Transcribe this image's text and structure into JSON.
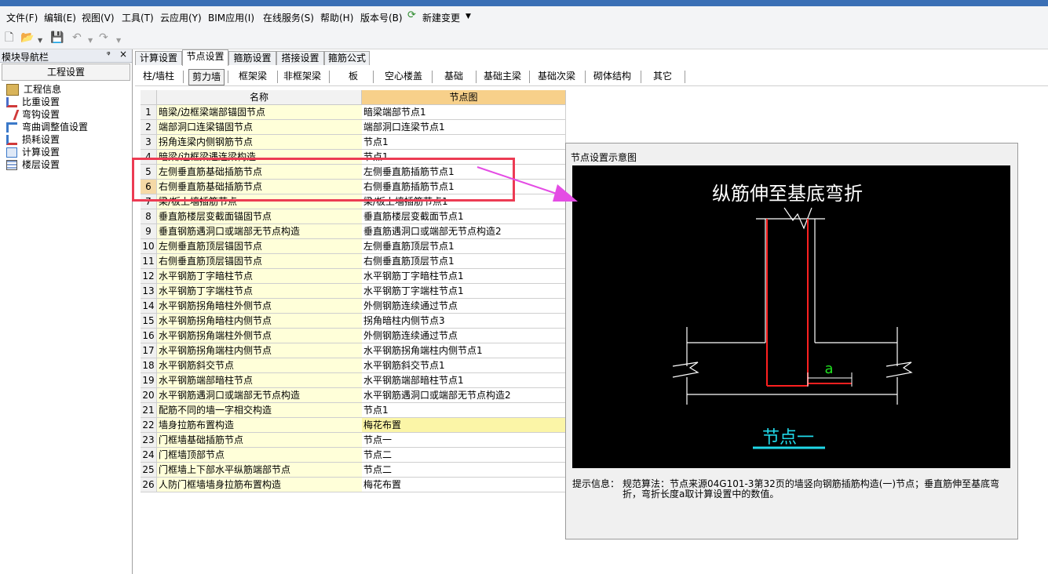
{
  "menu": [
    "文件(F)",
    "编辑(E)",
    "视图(V)",
    "工具(T)",
    "云应用(Y)",
    "BIM应用(I)",
    "在线服务(S)",
    "帮助(H)",
    "版本号(B)",
    "新建变更"
  ],
  "nav": {
    "title": "模块导航栏",
    "pin": "ᵠ",
    "close": "×",
    "group": "工程设置",
    "items": [
      "工程信息",
      "比重设置",
      "弯钩设置",
      "弯曲调整值设置",
      "损耗设置",
      "计算设置",
      "楼层设置"
    ]
  },
  "tabs": [
    "计算设置",
    "节点设置",
    "箍筋设置",
    "搭接设置",
    "箍筋公式"
  ],
  "subtabs": [
    "柱/墙柱",
    "剪力墙",
    "框架梁",
    "非框架梁",
    "板",
    "空心楼盖",
    "基础",
    "基础主梁",
    "基础次梁",
    "砌体结构",
    "其它"
  ],
  "table": {
    "headers": [
      "名称",
      "节点图"
    ],
    "rows": [
      {
        "no": "1",
        "name": "暗梁/边框梁端部锚固节点",
        "value": "暗梁端部节点1"
      },
      {
        "no": "2",
        "name": "端部洞口连梁锚固节点",
        "value": "端部洞口连梁节点1"
      },
      {
        "no": "3",
        "name": "拐角连梁内侧钢筋节点",
        "value": "节点1"
      },
      {
        "no": "4",
        "name": "暗梁/边框梁遇连梁构造",
        "value": "节点1"
      },
      {
        "no": "5",
        "name": "左侧垂直筋基础插筋节点",
        "value": "左侧垂直筋插筋节点1"
      },
      {
        "no": "6",
        "name": "右侧垂直筋基础插筋节点",
        "value": "右侧垂直筋插筋节点1"
      },
      {
        "no": "7",
        "name": "梁/板上墙插筋节点",
        "value": "梁/板上墙插筋节点1"
      },
      {
        "no": "8",
        "name": "垂直筋楼层变截面锚固节点",
        "value": "垂直筋楼层变截面节点1"
      },
      {
        "no": "9",
        "name": "垂直钢筋遇洞口或端部无节点构造",
        "value": "垂直筋遇洞口或端部无节点构造2"
      },
      {
        "no": "10",
        "name": "左侧垂直筋顶层锚固节点",
        "value": "左侧垂直筋顶层节点1"
      },
      {
        "no": "11",
        "name": "右侧垂直筋顶层锚固节点",
        "value": "右侧垂直筋顶层节点1"
      },
      {
        "no": "12",
        "name": "水平钢筋丁字暗柱节点",
        "value": "水平钢筋丁字暗柱节点1"
      },
      {
        "no": "13",
        "name": "水平钢筋丁字端柱节点",
        "value": "水平钢筋丁字端柱节点1"
      },
      {
        "no": "14",
        "name": "水平钢筋拐角暗柱外侧节点",
        "value": "外侧钢筋连续通过节点"
      },
      {
        "no": "15",
        "name": "水平钢筋拐角暗柱内侧节点",
        "value": "拐角暗柱内侧节点3"
      },
      {
        "no": "16",
        "name": "水平钢筋拐角端柱外侧节点",
        "value": "外侧钢筋连续通过节点"
      },
      {
        "no": "17",
        "name": "水平钢筋拐角端柱内侧节点",
        "value": "水平钢筋拐角端柱内侧节点1"
      },
      {
        "no": "18",
        "name": "水平钢筋斜交节点",
        "value": "水平钢筋斜交节点1"
      },
      {
        "no": "19",
        "name": "水平钢筋端部暗柱节点",
        "value": "水平钢筋端部暗柱节点1"
      },
      {
        "no": "20",
        "name": "水平钢筋遇洞口或端部无节点构造",
        "value": "水平钢筋遇洞口或端部无节点构造2"
      },
      {
        "no": "21",
        "name": "配筋不同的墙一字相交构造",
        "value": "节点1"
      },
      {
        "no": "22",
        "name": "墙身拉筋布置构造",
        "value": "梅花布置"
      },
      {
        "no": "23",
        "name": "门框墙基础插筋节点",
        "value": "节点一"
      },
      {
        "no": "24",
        "name": "门框墙顶部节点",
        "value": "节点二"
      },
      {
        "no": "25",
        "name": "门框墙上下部水平纵筋端部节点",
        "value": "节点二"
      },
      {
        "no": "26",
        "name": "人防门框墙墙身拉筋布置构造",
        "value": "梅花布置"
      }
    ]
  },
  "preview": {
    "title": "节点设置示意图",
    "diagram_title": "纵筋伸至基底弯折",
    "dim_label": "a",
    "node_label": "节点一",
    "info_label": "提示信息：",
    "info_text": "规范算法：节点来源04G101-3第32页的墙竖向钢筋插筋构造(一)节点；垂直筋伸至基底弯折，弯折长度a取计算设置中的数值。"
  },
  "colors": {
    "name_bg": "#ffffd9",
    "highlight": "#fbf5a7",
    "annotation": "#ec3b53",
    "arrow": "#e44ce4",
    "rebar": "#ff2020",
    "node_label": "#20d8e8",
    "dim": "#20e020"
  }
}
